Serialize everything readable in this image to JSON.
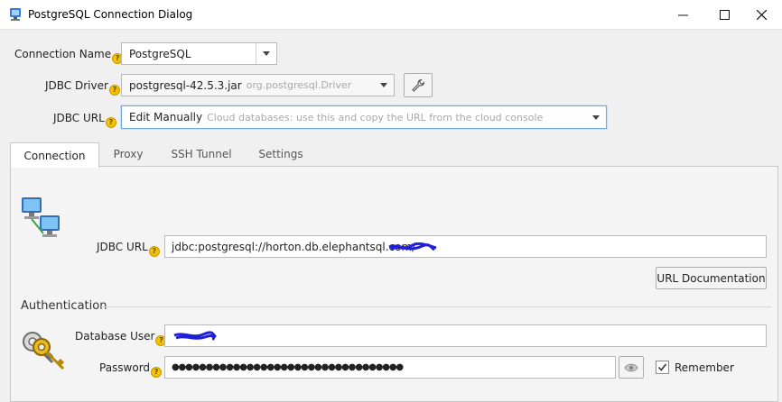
{
  "window": {
    "title": "PostgreSQL Connection Dialog"
  },
  "form": {
    "connection_name_label": "Connection Name",
    "connection_name_value": "PostgreSQL",
    "jdbc_driver_label": "JDBC Driver",
    "jdbc_driver_value": "postgresql-42.5.3.jar",
    "jdbc_driver_class": "org.postgresql.Driver",
    "jdbc_url_label": "JDBC URL",
    "jdbc_url_mode": "Edit Manually",
    "jdbc_url_mode_hint": "Cloud databases: use this and copy the URL from the cloud console"
  },
  "tabs": [
    {
      "label": "Connection"
    },
    {
      "label": "Proxy"
    },
    {
      "label": "SSH Tunnel"
    },
    {
      "label": "Settings"
    }
  ],
  "connection": {
    "jdbc_url_label": "JDBC URL",
    "jdbc_url_value": "jdbc:postgresql://horton.db.elephantsql.com/",
    "url_doc_button": "URL Documentation",
    "auth_heading": "Authentication",
    "db_user_label": "Database User",
    "password_label": "Password",
    "password_value": "●●●●●●●●●●●●●●●●●●●●●●●●●●●●●●●●●●",
    "remember_label": "Remember",
    "remember_checked": true
  },
  "icons": {
    "app": "app-icon",
    "wrench": "wrench-icon",
    "computers": "network-computers-icon",
    "keys": "keys-icon",
    "eye": "eye-icon"
  },
  "colors": {
    "accent": "#4a90d9",
    "redaction": "#1f1fd6"
  }
}
